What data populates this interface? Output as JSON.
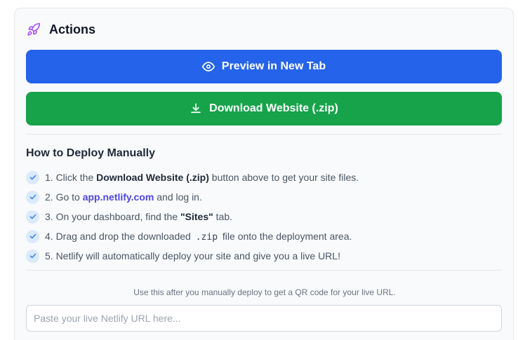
{
  "actions": {
    "title": "Actions",
    "preview_label": "Preview in New Tab",
    "download_label": "Download Website (.zip)"
  },
  "howto": {
    "title": "How to Deploy Manually",
    "steps": [
      {
        "pre": "1. Click the ",
        "bold": "Download Website (.zip)",
        "post": " button above to get your site files."
      },
      {
        "pre": "2. Go to ",
        "link": "app.netlify.com",
        "post": " and log in."
      },
      {
        "pre": "3. On your dashboard, find the ",
        "bold": "\"Sites\"",
        "post": " tab."
      },
      {
        "pre": "4. Drag and drop the downloaded ",
        "code": ".zip",
        "post": " file onto the deployment area."
      },
      {
        "pre": "5. Netlify will automatically deploy your site and give you a live URL!"
      }
    ]
  },
  "qr": {
    "note": "Use this after you manually deploy to get a QR code for your live URL.",
    "placeholder": "Paste your live Netlify URL here..."
  },
  "colors": {
    "preview_button": "#2563eb",
    "download_button": "#16a34a",
    "rocket": "#a855f7",
    "link": "#4f46e5"
  }
}
